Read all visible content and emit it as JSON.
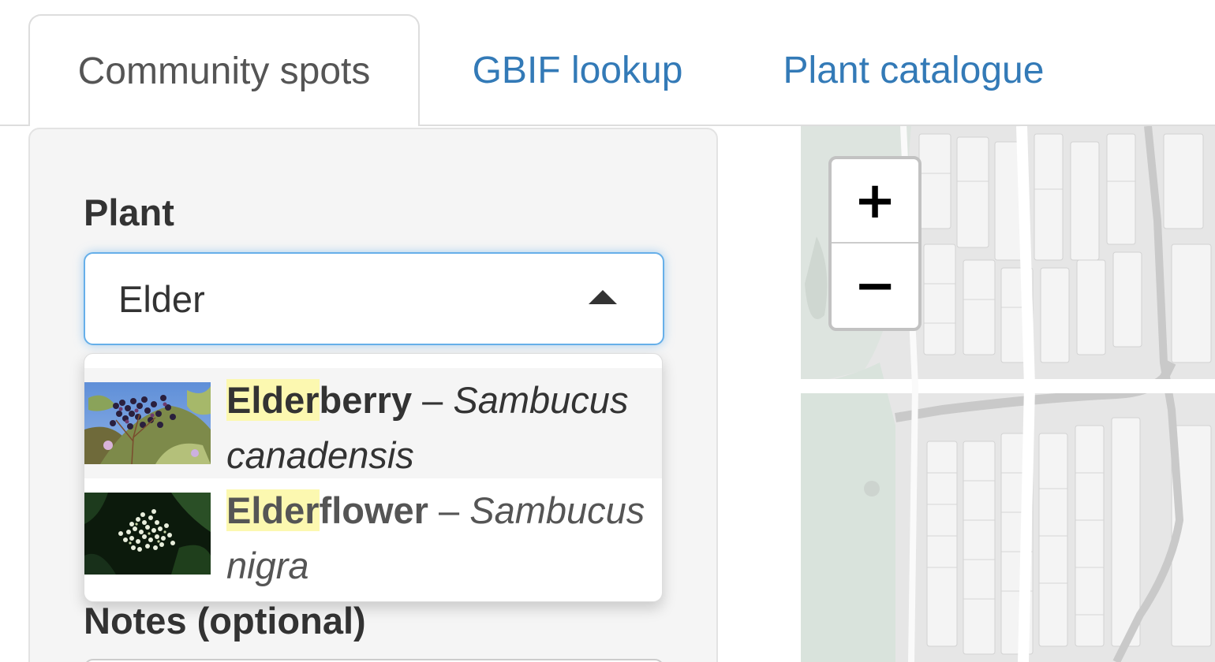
{
  "tabs": [
    {
      "label": "Community spots",
      "active": true
    },
    {
      "label": "GBIF lookup",
      "active": false
    },
    {
      "label": "Plant catalogue",
      "active": false
    }
  ],
  "form": {
    "plant_label": "Plant",
    "plant_value": "Elder",
    "notes_label": "Notes (optional)"
  },
  "dropdown": {
    "options": [
      {
        "match": "Elder",
        "rest": "berry",
        "separator": " – ",
        "scientific": "Sambucus canadensis",
        "thumb": "elderberry-photo"
      },
      {
        "match": "Elder",
        "rest": "flower",
        "separator": " – ",
        "scientific": "Sambucus nigra",
        "thumb": "elderflower-photo"
      }
    ]
  },
  "map": {
    "zoom_in_label": "+",
    "zoom_out_label": "−"
  },
  "colors": {
    "link": "#337ab7",
    "focus_border": "#66afe9",
    "highlight": "#fcf8b0"
  }
}
